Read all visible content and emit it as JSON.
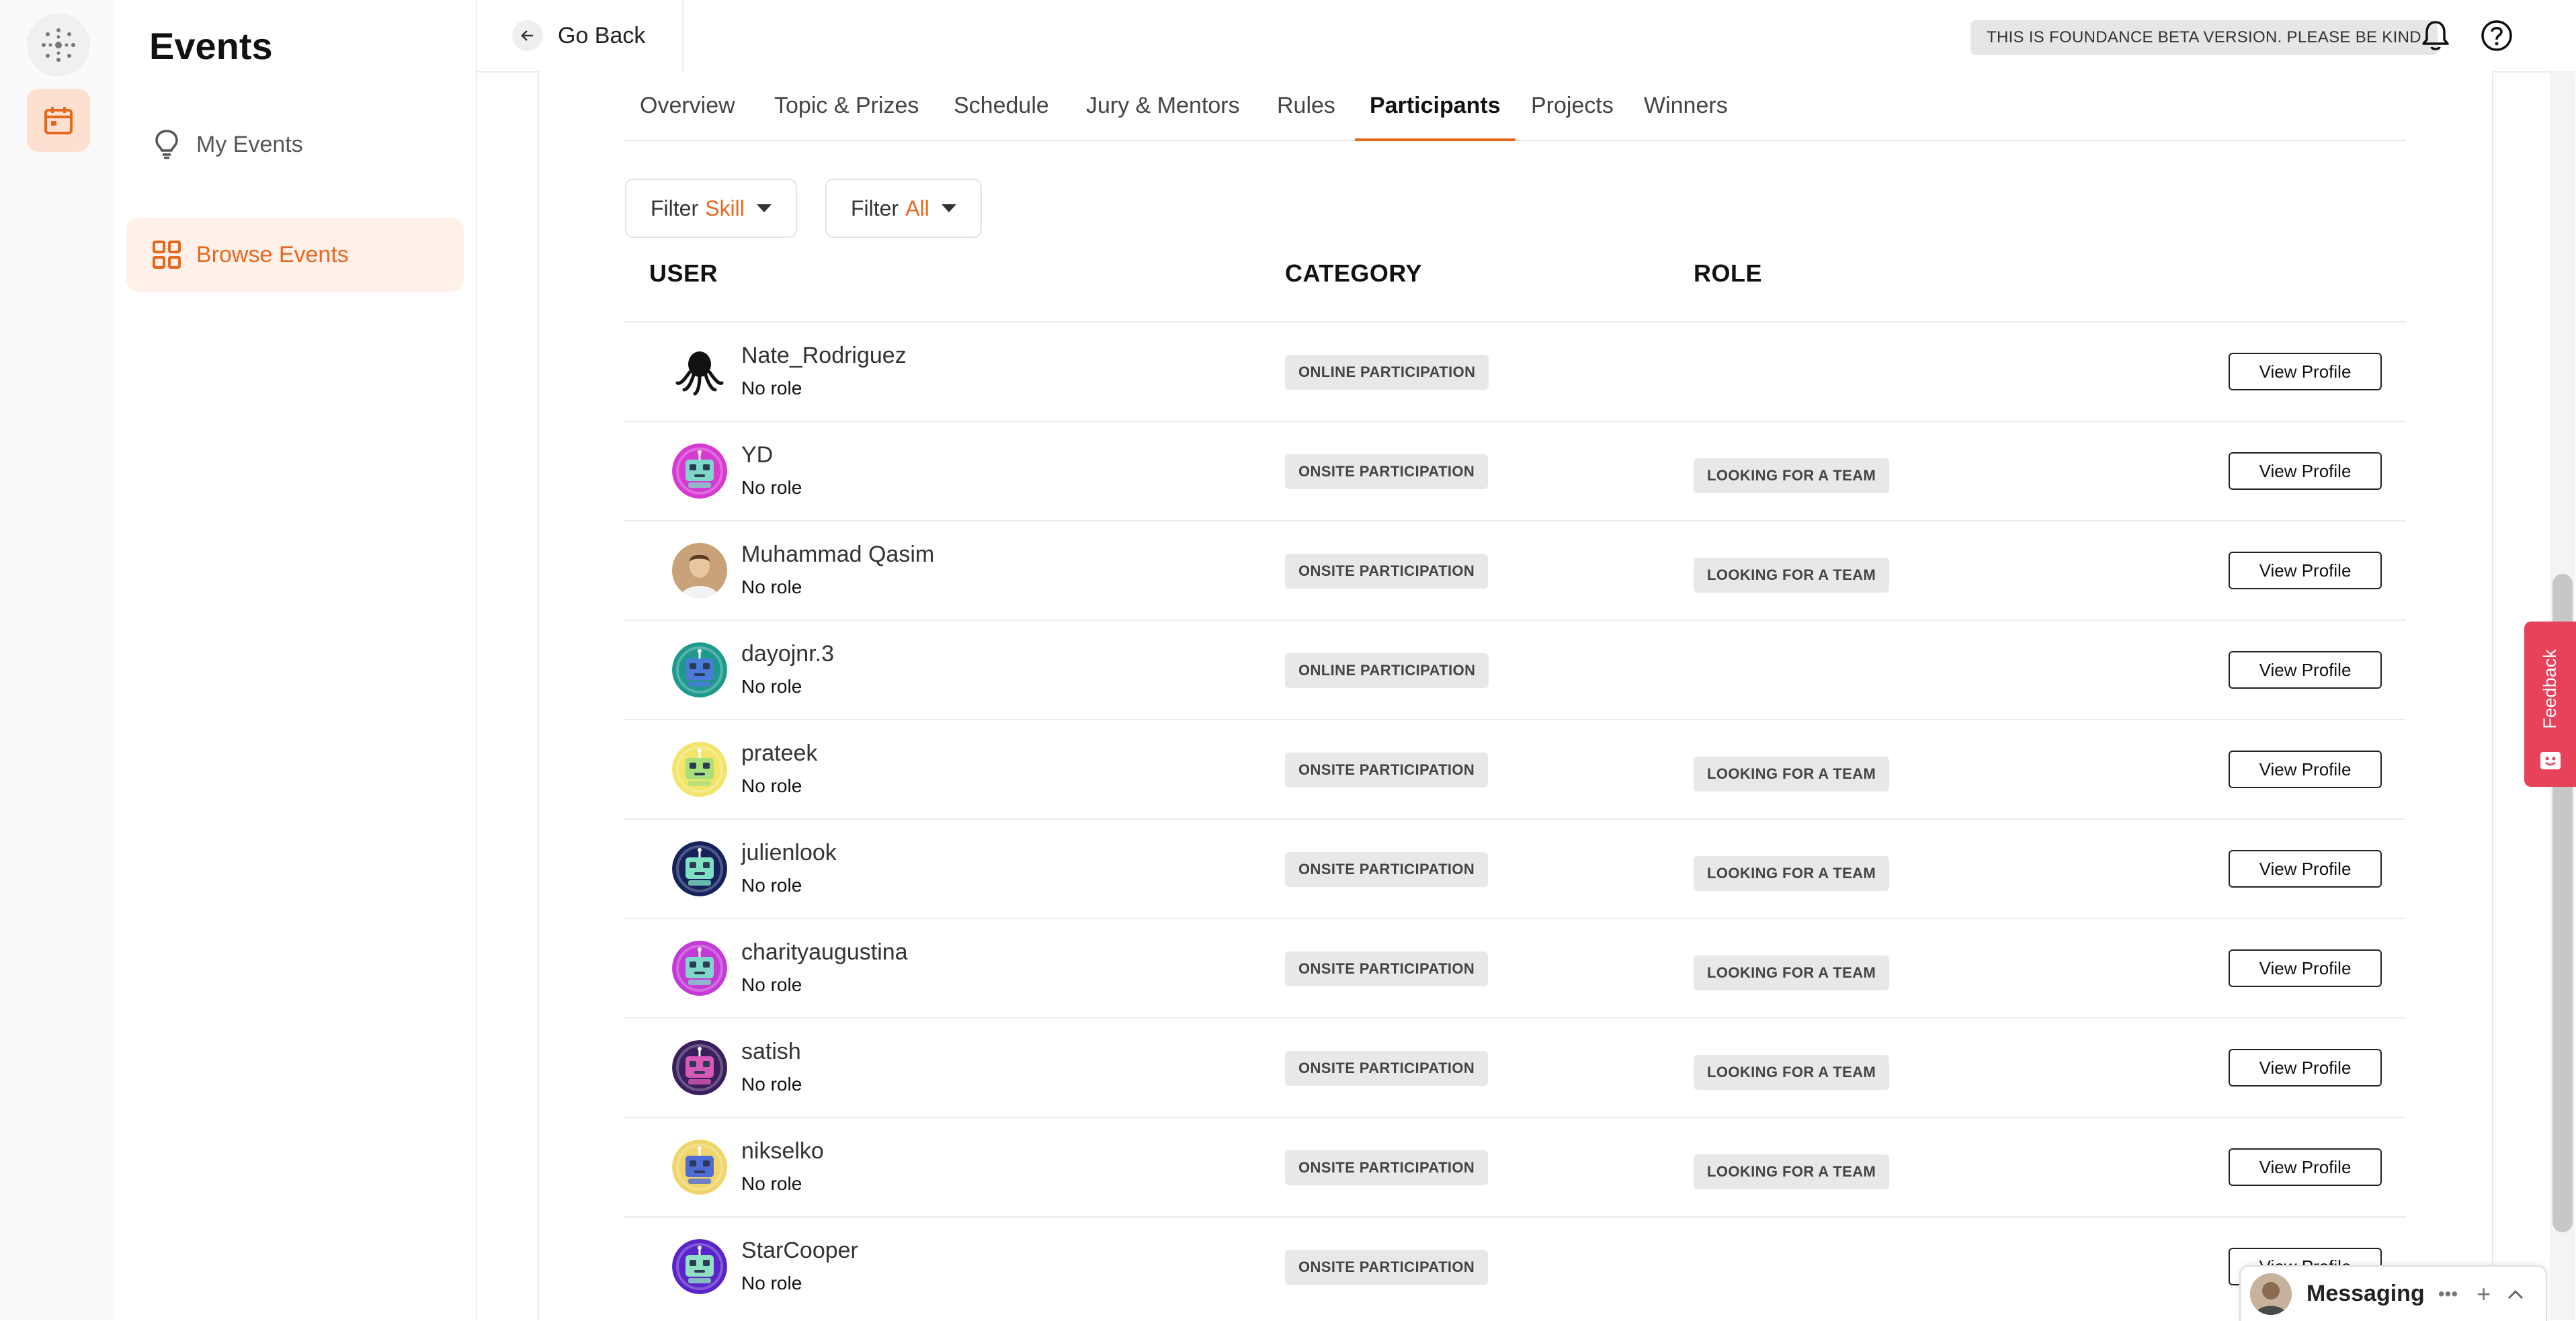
{
  "sidebar": {
    "title": "Events",
    "items": [
      {
        "label": "My Events",
        "icon": "lightbulb-icon",
        "active": false
      },
      {
        "label": "Browse Events",
        "icon": "grid-icon",
        "active": true
      }
    ]
  },
  "topbar": {
    "back_label": "Go Back",
    "beta_notice": "THIS IS FOUNDANCE BETA VERSION. PLEASE BE KIND",
    "icons": [
      "bell-icon",
      "help-icon"
    ]
  },
  "tabs": [
    "Overview",
    "Topic & Prizes",
    "Schedule",
    "Jury & Mentors",
    "Rules",
    "Participants",
    "Projects",
    "Winners"
  ],
  "active_tab": "Participants",
  "filters": [
    {
      "prefix": "Filter",
      "value": "Skill"
    },
    {
      "prefix": "Filter",
      "value": "All"
    }
  ],
  "columns": {
    "user": "USER",
    "category": "CATEGORY",
    "role": "ROLE"
  },
  "participants": [
    {
      "name": "Nate_Rodriguez",
      "role": "No role",
      "category": "ONLINE PARTICIPATION",
      "tag": "",
      "action": "View Profile"
    },
    {
      "name": "YD",
      "role": "No role",
      "category": "ONSITE PARTICIPATION",
      "tag": "LOOKING FOR A TEAM",
      "action": "View Profile"
    },
    {
      "name": "Muhammad Qasim",
      "role": "No role",
      "category": "ONSITE PARTICIPATION",
      "tag": "LOOKING FOR A TEAM",
      "action": "View Profile"
    },
    {
      "name": "dayojnr.3",
      "role": "No role",
      "category": "ONLINE PARTICIPATION",
      "tag": "",
      "action": "View Profile"
    },
    {
      "name": "prateek",
      "role": "No role",
      "category": "ONSITE PARTICIPATION",
      "tag": "LOOKING FOR A TEAM",
      "action": "View Profile"
    },
    {
      "name": "julienlook",
      "role": "No role",
      "category": "ONSITE PARTICIPATION",
      "tag": "LOOKING FOR A TEAM",
      "action": "View Profile"
    },
    {
      "name": "charityaugustina",
      "role": "No role",
      "category": "ONSITE PARTICIPATION",
      "tag": "LOOKING FOR A TEAM",
      "action": "View Profile"
    },
    {
      "name": "satish",
      "role": "No role",
      "category": "ONSITE PARTICIPATION",
      "tag": "LOOKING FOR A TEAM",
      "action": "View Profile"
    },
    {
      "name": "nikselko",
      "role": "No role",
      "category": "ONSITE PARTICIPATION",
      "tag": "LOOKING FOR A TEAM",
      "action": "View Profile"
    },
    {
      "name": "StarCooper",
      "role": "No role",
      "category": "ONSITE PARTICIPATION",
      "tag": "",
      "action": "View Profile"
    }
  ],
  "avatars": [
    {
      "kind": "octopus",
      "bg": "#ffffff",
      "fg": "#111111"
    },
    {
      "kind": "robot",
      "bg": "#d63ad0",
      "fg": "#7fd7c9"
    },
    {
      "kind": "photo",
      "bg": "#c9a27a",
      "fg": "#5a3b22"
    },
    {
      "kind": "robot",
      "bg": "#1e9a8c",
      "fg": "#4a7bd6"
    },
    {
      "kind": "robot",
      "bg": "#f2e56a",
      "fg": "#a9e07a"
    },
    {
      "kind": "robot",
      "bg": "#15225c",
      "fg": "#7fe0c2"
    },
    {
      "kind": "robot",
      "bg": "#c33ad6",
      "fg": "#7fd7c9"
    },
    {
      "kind": "robot",
      "bg": "#3a1f5c",
      "fg": "#d659b8"
    },
    {
      "kind": "robot",
      "bg": "#f0d56a",
      "fg": "#4f6bd6"
    },
    {
      "kind": "robot",
      "bg": "#5a24c9",
      "fg": "#8fe0c0"
    }
  ],
  "feedback_label": "Feedback",
  "messaging_label": "Messaging",
  "colors": {
    "accent": "#e8671e",
    "feedback": "#e8415a"
  }
}
